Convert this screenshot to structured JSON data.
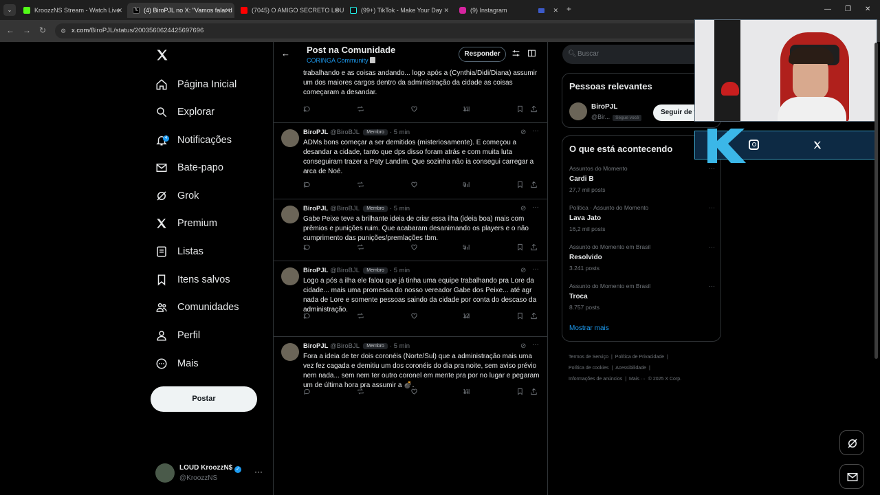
{
  "browser": {
    "tabs": [
      {
        "label": "KroozzNS Stream - Watch Live",
        "active": false
      },
      {
        "label": "(4) BiroPJL no X: \"Vamos falar d",
        "active": true
      },
      {
        "label": "(7045) O AMIGO SECRETO LOU",
        "active": false
      },
      {
        "label": "(99+) TikTok - Make Your Day",
        "active": false
      },
      {
        "label": "(9) Instagram",
        "active": false
      }
    ],
    "url_host": "x.com",
    "url_path": "/BiroPJL/status/2003560624425697696"
  },
  "nav": {
    "items": [
      {
        "label": "Página Inicial",
        "icon": "home-icon"
      },
      {
        "label": "Explorar",
        "icon": "search-icon"
      },
      {
        "label": "Notificações",
        "icon": "bell-icon",
        "badge": "4"
      },
      {
        "label": "Bate-papo",
        "icon": "mail-icon"
      },
      {
        "label": "Grok",
        "icon": "grok-icon"
      },
      {
        "label": "Premium",
        "icon": "x-icon"
      },
      {
        "label": "Listas",
        "icon": "list-icon"
      },
      {
        "label": "Itens salvos",
        "icon": "bookmark-icon"
      },
      {
        "label": "Comunidades",
        "icon": "people-icon"
      },
      {
        "label": "Perfil",
        "icon": "person-icon"
      },
      {
        "label": "Mais",
        "icon": "more-circle-icon"
      }
    ],
    "post_button": "Postar",
    "account": {
      "name": "LOUD KroozzN$",
      "handle": "@KroozzNS"
    }
  },
  "main": {
    "title": "Post na Comunidade",
    "community": "CORINGA Community",
    "reply_button": "Responder",
    "partial_post": {
      "text": "trabalhando e as coisas andando... logo após a (Cynthia/Didi/Diana) assumir um dos maiores cargos dentro da administração da cidade as coisas começaram a desandar.",
      "replies": "1",
      "views": "11"
    },
    "posts": [
      {
        "name": "BiroPJL",
        "handle": "@BiroBJL",
        "badge": "Membro",
        "time": "5 min",
        "text": "ADMs bons começar a ser demitidos (misteriosamente). E começou a desandar a cidade, tanto que dps disso foram atrás e com muita luta conseguiram trazer a Paty Landim. Que sozinha não ia consegui carregar a arca de Noé.",
        "replies": "1",
        "views": "8"
      },
      {
        "name": "BiroPJL",
        "handle": "@BiroBJL",
        "badge": "Membro",
        "time": "5 min",
        "text": "Gabe Peixe teve a brilhante ideia de criar essa ilha (ideia boa) mais com prêmios e punições ruim. Que acabaram desanimando os players e o não cumprimento das punições/premlações tbm.",
        "replies": "1",
        "views": "5"
      },
      {
        "name": "BiroPJL",
        "handle": "@BiroBJL",
        "badge": "Membro",
        "time": "5 min",
        "text": "Logo a pós a ilha ele falou que já tinha uma equipe trabalhando pra Lore da cidade... mais uma promessa do nosso vereador Gabe dos Peixe... até agr nada de Lore e somente pessoas saindo da cidade por conta do descaso da administração.",
        "replies": "1",
        "views": "12"
      },
      {
        "name": "BiroPJL",
        "handle": "@BiroBJL",
        "badge": "Membro",
        "time": "5 min",
        "text": "Fora a ideia de ter dois coronéis (Norte/Sul) que a administração mais uma vez fez cagada e demitiu um dos coronéis do dia pra noite, sem aviso prévio nem nada... sem nem ter outro coronel em mente pra por no lugar e pegaram um de última hora pra assumir a 💣.",
        "replies": "",
        "views": "11"
      }
    ]
  },
  "sidebar": {
    "search_placeholder": "Buscar",
    "relevant_title": "Pessoas relevantes",
    "relevant_user": {
      "name": "BiroPJL",
      "handle": "@Bir...",
      "follows_you": "Segue você"
    },
    "follow_button": "Seguir de v",
    "trending_title": "O que está acontecendo",
    "trends": [
      {
        "context": "Assuntos do Momento",
        "topic": "Cardi B",
        "posts": "27,7 mil posts"
      },
      {
        "context": "Política · Assunto do Momento",
        "topic": "Lava Jato",
        "posts": "16,2 mil posts"
      },
      {
        "context": "Assunto do Momento em Brasil",
        "topic": "Resolvido",
        "posts": "3.241 posts"
      },
      {
        "context": "Assunto do Momento em Brasil",
        "topic": "Troca",
        "posts": "8.757 posts"
      }
    ],
    "show_more": "Mostrar mais",
    "footer": [
      "Termos de Serviço",
      "|",
      "Política de Privacidade",
      "|",
      "Política de cookies",
      "|",
      "Acessibilidade",
      "|",
      "Informações de anúncios",
      "|",
      "Mais ···",
      "© 2025 X Corp."
    ]
  },
  "colors": {
    "accent": "#1d9bf0",
    "bg": "#000000",
    "border": "#2f3336",
    "muted": "#71767b"
  }
}
